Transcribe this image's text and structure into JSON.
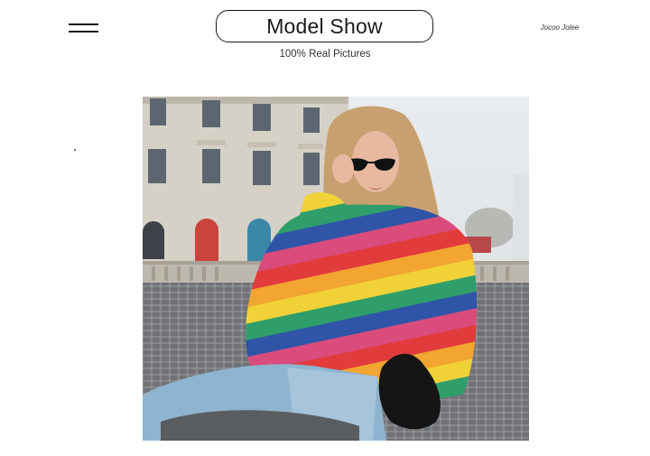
{
  "header": {
    "menu_icon": "hamburger-menu-icon",
    "title": "Model Show",
    "subtitle": "100% Real Pictures",
    "brand": "Jocoo Jolee"
  },
  "colors": {
    "text": "#1a1a1a",
    "background": "#ffffff",
    "sweater_stripes": [
      "#e23b3b",
      "#f2a531",
      "#f0d238",
      "#2f9e6a",
      "#2f54a8",
      "#d94c7c"
    ]
  }
}
